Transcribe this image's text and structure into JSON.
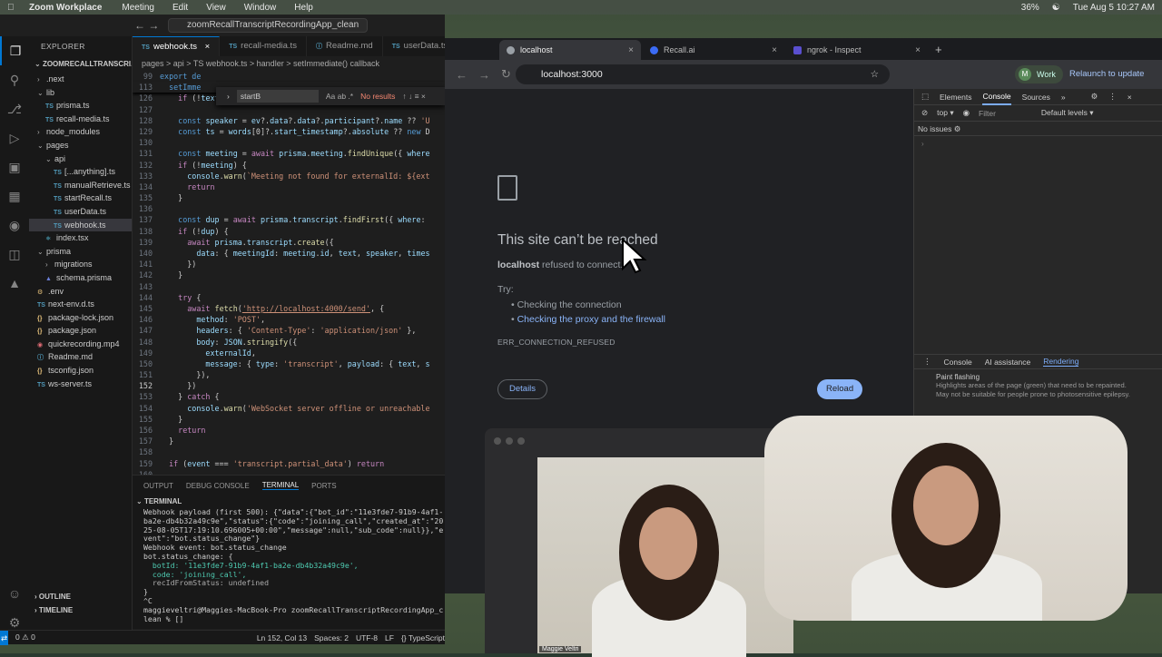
{
  "menubar": {
    "app": "Zoom Workplace",
    "items": [
      "Meeting",
      "Edit",
      "View",
      "Window",
      "Help"
    ],
    "battery": "36%",
    "datetime": "Tue Aug 5  10:27 AM"
  },
  "vscode": {
    "search": "zoomRecallTranscriptRecordingApp_clean",
    "explorer_title": "EXPLORER",
    "root": "ZOOMRECALLTRANSCRI...",
    "tree": [
      {
        "label": ".next",
        "type": "folder",
        "indent": 1
      },
      {
        "label": "lib",
        "type": "folder-open",
        "indent": 1
      },
      {
        "label": "prisma.ts",
        "type": "ts",
        "indent": 2
      },
      {
        "label": "recall-media.ts",
        "type": "ts",
        "indent": 2
      },
      {
        "label": "node_modules",
        "type": "folder",
        "indent": 1
      },
      {
        "label": "pages",
        "type": "folder-open",
        "indent": 1
      },
      {
        "label": "api",
        "type": "folder-open",
        "indent": 2
      },
      {
        "label": "[...anything].ts",
        "type": "ts",
        "indent": 3
      },
      {
        "label": "manualRetrieve.ts",
        "type": "ts",
        "indent": 3
      },
      {
        "label": "startRecall.ts",
        "type": "ts",
        "indent": 3
      },
      {
        "label": "userData.ts",
        "type": "ts",
        "indent": 3
      },
      {
        "label": "webhook.ts",
        "type": "ts",
        "indent": 3,
        "selected": true
      },
      {
        "label": "index.tsx",
        "type": "tsx",
        "indent": 2
      },
      {
        "label": "prisma",
        "type": "folder-open",
        "indent": 1
      },
      {
        "label": "migrations",
        "type": "folder",
        "indent": 2
      },
      {
        "label": "schema.prisma",
        "type": "prisma",
        "indent": 2
      },
      {
        "label": ".env",
        "type": "env",
        "indent": 1
      },
      {
        "label": "next-env.d.ts",
        "type": "ts",
        "indent": 1
      },
      {
        "label": "package-lock.json",
        "type": "json",
        "indent": 1
      },
      {
        "label": "package.json",
        "type": "json",
        "indent": 1
      },
      {
        "label": "quickrecording.mp4",
        "type": "mp4",
        "indent": 1
      },
      {
        "label": "Readme.md",
        "type": "md",
        "indent": 1
      },
      {
        "label": "tsconfig.json",
        "type": "json",
        "indent": 1
      },
      {
        "label": "ws-server.ts",
        "type": "ts",
        "indent": 1
      }
    ],
    "outline": "OUTLINE",
    "timeline": "TIMELINE",
    "tabs": [
      {
        "label": "webhook.ts",
        "active": true
      },
      {
        "label": "recall-media.ts"
      },
      {
        "label": "Readme.md"
      },
      {
        "label": "userData.ts"
      }
    ],
    "breadcrumb": "pages > api > TS webhook.ts > handler > setImmediate() callback",
    "find": {
      "value": "startB",
      "result": "No results"
    },
    "sticky": [
      {
        "n": "99",
        "t": "export de"
      },
      {
        "n": "113",
        "t": "  setImme"
      }
    ],
    "code": [
      {
        "n": "126",
        "html": "    <span class='kw'>if</span> (!<span class='var'>text</span>) <span class='kw'>return</span>"
      },
      {
        "n": "127",
        "html": ""
      },
      {
        "n": "128",
        "html": "    <span class='kb'>const</span> <span class='var'>speaker</span> = <span class='var'>ev</span>?.<span class='var'>data</span>?.<span class='var'>data</span>?.<span class='var'>participant</span>?.<span class='var'>name</span> ?? <span class='str'>'U</span>"
      },
      {
        "n": "129",
        "html": "    <span class='kb'>const</span> <span class='var'>ts</span> = <span class='var'>words</span>[0]?.<span class='var'>start_timestamp</span>?.<span class='var'>absolute</span> ?? <span class='kb'>new</span> D"
      },
      {
        "n": "130",
        "html": ""
      },
      {
        "n": "131",
        "html": "    <span class='kb'>const</span> <span class='var'>meeting</span> = <span class='kw'>await</span> <span class='var'>prisma</span>.<span class='var'>meeting</span>.<span class='fn'>findUnique</span>({ <span class='var'>where</span>"
      },
      {
        "n": "132",
        "html": "    <span class='kw'>if</span> (!<span class='var'>meeting</span>) {"
      },
      {
        "n": "133",
        "html": "      <span class='var'>console</span>.<span class='fn'>warn</span>(<span class='str'>`Meeting not found for externalId: ${ext</span>"
      },
      {
        "n": "134",
        "html": "      <span class='kw'>return</span>"
      },
      {
        "n": "135",
        "html": "    }"
      },
      {
        "n": "136",
        "html": ""
      },
      {
        "n": "137",
        "html": "    <span class='kb'>const</span> <span class='var'>dup</span> = <span class='kw'>await</span> <span class='var'>prisma</span>.<span class='var'>transcript</span>.<span class='fn'>findFirst</span>({ <span class='var'>where</span>:"
      },
      {
        "n": "138",
        "html": "    <span class='kw'>if</span> (!<span class='var'>dup</span>) {"
      },
      {
        "n": "139",
        "html": "      <span class='kw'>await</span> <span class='var'>prisma</span>.<span class='var'>transcript</span>.<span class='fn'>create</span>({"
      },
      {
        "n": "140",
        "html": "        <span class='var'>data</span>: { <span class='var'>meetingId</span>: <span class='var'>meeting</span>.<span class='var'>id</span>, <span class='var'>text</span>, <span class='var'>speaker</span>, <span class='var'>times</span>"
      },
      {
        "n": "141",
        "html": "      })"
      },
      {
        "n": "142",
        "html": "    }"
      },
      {
        "n": "143",
        "html": ""
      },
      {
        "n": "144",
        "html": "    <span class='kw'>try</span> {"
      },
      {
        "n": "145",
        "html": "      <span class='kw'>await</span> <span class='fn'>fetch</span>(<span class='lk'>'http://localhost:4000/send'</span>, {"
      },
      {
        "n": "146",
        "html": "        <span class='var'>method</span>: <span class='str'>'POST'</span>,"
      },
      {
        "n": "147",
        "html": "        <span class='var'>headers</span>: { <span class='str'>'Content-Type'</span>: <span class='str'>'application/json'</span> },"
      },
      {
        "n": "148",
        "html": "        <span class='var'>body</span>: <span class='var'>JSON</span>.<span class='fn'>stringify</span>({"
      },
      {
        "n": "149",
        "html": "          <span class='var'>externalId</span>,"
      },
      {
        "n": "150",
        "html": "          <span class='var'>message</span>: { <span class='var'>type</span>: <span class='str'>'transcript'</span>, <span class='var'>payload</span>: { <span class='var'>text</span>, <span class='var'>s</span>"
      },
      {
        "n": "151",
        "html": "        }),"
      },
      {
        "n": "152",
        "html": "      })"
      },
      {
        "n": "153",
        "html": "    } <span class='kw'>catch</span> {"
      },
      {
        "n": "154",
        "html": "      <span class='var'>console</span>.<span class='fn'>warn</span>(<span class='str'>'WebSocket server offline or unreachable</span>"
      },
      {
        "n": "155",
        "html": "    }"
      },
      {
        "n": "156",
        "html": "    <span class='kw'>return</span>"
      },
      {
        "n": "157",
        "html": "  }"
      },
      {
        "n": "158",
        "html": ""
      },
      {
        "n": "159",
        "html": "  <span class='kw'>if</span> (<span class='var'>event</span> === <span class='str'>'transcript.partial_data'</span>) <span class='kw'>return</span>"
      },
      {
        "n": "160",
        "html": ""
      }
    ],
    "panel_tabs": [
      "OUTPUT",
      "DEBUG CONSOLE",
      "TERMINAL",
      "PORTS"
    ],
    "terminal_title": "TERMINAL",
    "terminal": [
      "Webhook payload (first 500): {\"data\":{\"bot_id\":\"11e3fde7-91b9-4af1-",
      "ba2e-db4b32a49c9e\",\"status\":{\"code\":\"joining_call\",\"created_at\":\"20",
      "25-08-05T17:19:10.696005+00:00\",\"message\":null,\"sub_code\":null}},\"e",
      "vent\":\"bot.status_change\"}",
      "Webhook event: bot.status_change",
      "bot.status_change: {",
      "  botId: '11e3fde7-91b9-4af1-ba2e-db4b32a49c9e',",
      "  code: 'joining_call',",
      "  recIdFromStatus: undefined",
      "}",
      "^C",
      "maggieveltri@Maggies-MacBook-Pro zoomRecallTranscriptRecordingApp_c",
      "lean % []"
    ],
    "status": {
      "problems": "0 ⚠ 0",
      "position": "Ln 152, Col 13",
      "spaces": "Spaces: 2",
      "encoding": "UTF-8",
      "eol": "LF",
      "lang": "{} TypeScript"
    }
  },
  "chrome": {
    "tabs": [
      {
        "label": "localhost",
        "active": true
      },
      {
        "label": "Recall.ai"
      },
      {
        "label": "ngrok - Inspect"
      }
    ],
    "url": "localhost:3000",
    "profile": "Work",
    "relaunch": "Relaunch to update",
    "error": {
      "title": "This site can’t be reached",
      "host": "localhost",
      "sub": "refused to connect.",
      "try": "Try:",
      "items": [
        "Checking the connection",
        "Checking the proxy and the firewall"
      ],
      "code": "ERR_CONNECTION_REFUSED",
      "details": "Details",
      "reload": "Reload"
    },
    "devtools": {
      "tabs": [
        "Elements",
        "Console",
        "Sources"
      ],
      "context": "top",
      "filter": "Filter",
      "levels": "Default levels",
      "issues": "No issues",
      "drawer_tabs": [
        "Console",
        "AI assistance",
        "Rendering"
      ],
      "paint_title": "Paint flashing",
      "paint_desc": "Highlights areas of the page (green) that need to be repainted. May not be suitable for people prone to photosensitive epilepsy."
    }
  },
  "video": {
    "name": "Maggie Veltri"
  }
}
